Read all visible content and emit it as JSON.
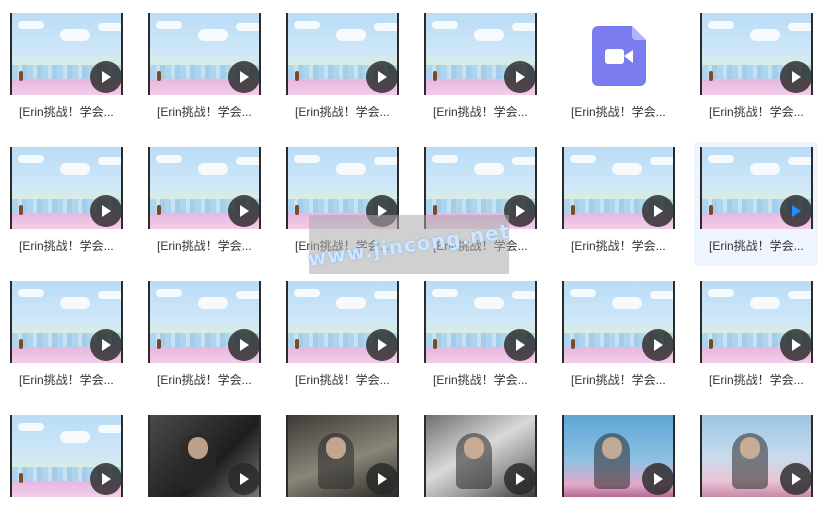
{
  "items": [
    {
      "label": "[Erin挑战！学会...",
      "thumb": "sky"
    },
    {
      "label": "[Erin挑战！学会...",
      "thumb": "sky"
    },
    {
      "label": "[Erin挑战！学会...",
      "thumb": "sky"
    },
    {
      "label": "[Erin挑战！学会...",
      "thumb": "sky"
    },
    {
      "label": "[Erin挑战！学会...",
      "thumb": "file",
      "icon": "video-file-icon"
    },
    {
      "label": "[Erin挑战！学会...",
      "thumb": "sky"
    },
    {
      "label": "[Erin挑战！学会...",
      "thumb": "sky"
    },
    {
      "label": "[Erin挑战！学会...",
      "thumb": "sky"
    },
    {
      "label": "[Erin挑战！学会...",
      "thumb": "sky"
    },
    {
      "label": "[Erin挑战！学会...",
      "thumb": "sky"
    },
    {
      "label": "[Erin挑战！学会...",
      "thumb": "sky"
    },
    {
      "label": "[Erin挑战！学会...",
      "thumb": "sky",
      "hovered": true
    },
    {
      "label": "[Erin挑战！学会...",
      "thumb": "sky"
    },
    {
      "label": "[Erin挑战！学会...",
      "thumb": "sky"
    },
    {
      "label": "[Erin挑战！学会...",
      "thumb": "sky"
    },
    {
      "label": "[Erin挑战！学会...",
      "thumb": "sky"
    },
    {
      "label": "[Erin挑战！学会...",
      "thumb": "sky"
    },
    {
      "label": "[Erin挑战！学会...",
      "thumb": "sky"
    },
    {
      "label": "",
      "thumb": "sky"
    },
    {
      "label": "",
      "thumb": "dark"
    },
    {
      "label": "",
      "thumb": "dark2"
    },
    {
      "label": "",
      "thumb": "paper"
    },
    {
      "label": "",
      "thumb": "show"
    },
    {
      "label": "",
      "thumb": "show2"
    }
  ],
  "colors": {
    "play_default": "#ffffff",
    "play_active": "#1e8fff",
    "file_icon": "#7b7cf0"
  },
  "watermark": {
    "text": "www.jincong.net"
  }
}
